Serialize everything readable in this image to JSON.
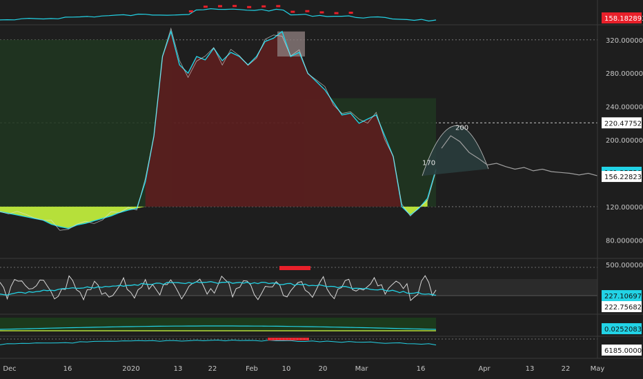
{
  "chart_data": {
    "type": "line",
    "title": "",
    "x_axis": {
      "tick_labels": [
        "Dec",
        "16",
        "2020",
        "13",
        "22",
        "Feb",
        "10",
        "20",
        "Mar",
        "16",
        "Apr",
        "13",
        "22",
        "May"
      ]
    },
    "panels": [
      {
        "name": "",
        "ticks": [
          "158.18289326"
        ],
        "price_tags": [
          {
            "label": "158.18289326",
            "color": "#e8202a"
          }
        ]
      },
      {
        "name": "",
        "ylim": [
          58,
          338
        ],
        "ticks": [
          "320.0000000",
          "280.0000000",
          "240.0000000",
          "200.0000000",
          "120.0000000",
          "80.0000000"
        ],
        "price_tags": [
          {
            "label": "220.4775246",
            "color": "#ffffff",
            "value": 220.48
          },
          {
            "label": "161.2575000",
            "color": "#22d3e6",
            "value": 161.26
          },
          {
            "label": "156.2282326",
            "color": "#ffffff",
            "value": 156.23
          }
        ],
        "annotations": [
          "170",
          "200"
        ],
        "series": [
          {
            "values": [
              114,
              112,
              110,
              108,
              106,
              104,
              99,
              96,
              94,
              98,
              100,
              103,
              106,
              109,
              113,
              116,
              118,
              150,
              205,
              300,
              330,
              290,
              280,
              300,
              296,
              310,
              295,
              305,
              300,
              290,
              300,
              318,
              322,
              330,
              300,
              305,
              280,
              270,
              260,
              245,
              230,
              232,
              220,
              225,
              230,
              205,
              180,
              120,
              110,
              118,
              130,
              165
            ]
          }
        ],
        "projection": [
          {
            "values": [
              190,
              205,
              198,
              185,
              178,
              170,
              172,
              168,
              165,
              167,
              163,
              165,
              162,
              161,
              160,
              158,
              160,
              157
            ]
          }
        ]
      },
      {
        "name": "",
        "ticks": [
          "500.0000000"
        ],
        "price_tags": [
          {
            "label": "227.1069711",
            "color": "#22d3e6"
          },
          {
            "label": "222.7568260",
            "color": "#ffffff"
          }
        ]
      },
      {
        "name": "",
        "ticks": [],
        "price_tags": [
          {
            "label": "0.02520833",
            "color": "#22d3e6"
          }
        ]
      },
      {
        "name": "",
        "ticks": [],
        "price_tags": [
          {
            "label": "6185.00000",
            "color": "#ffffff"
          }
        ]
      }
    ],
    "colors": {
      "background": "#1e1e1e",
      "main_line": "#22d3e6",
      "fill_above": "#5a1f1f",
      "fill_below": "#1f3520",
      "lime_fill": "#b6e03a",
      "red_marker": "#e8202a",
      "projection": "#a0a0a0",
      "osc_white": "#d8d8d8",
      "grid": "#8a8a8a"
    },
    "grid": "horizontal dashed"
  }
}
